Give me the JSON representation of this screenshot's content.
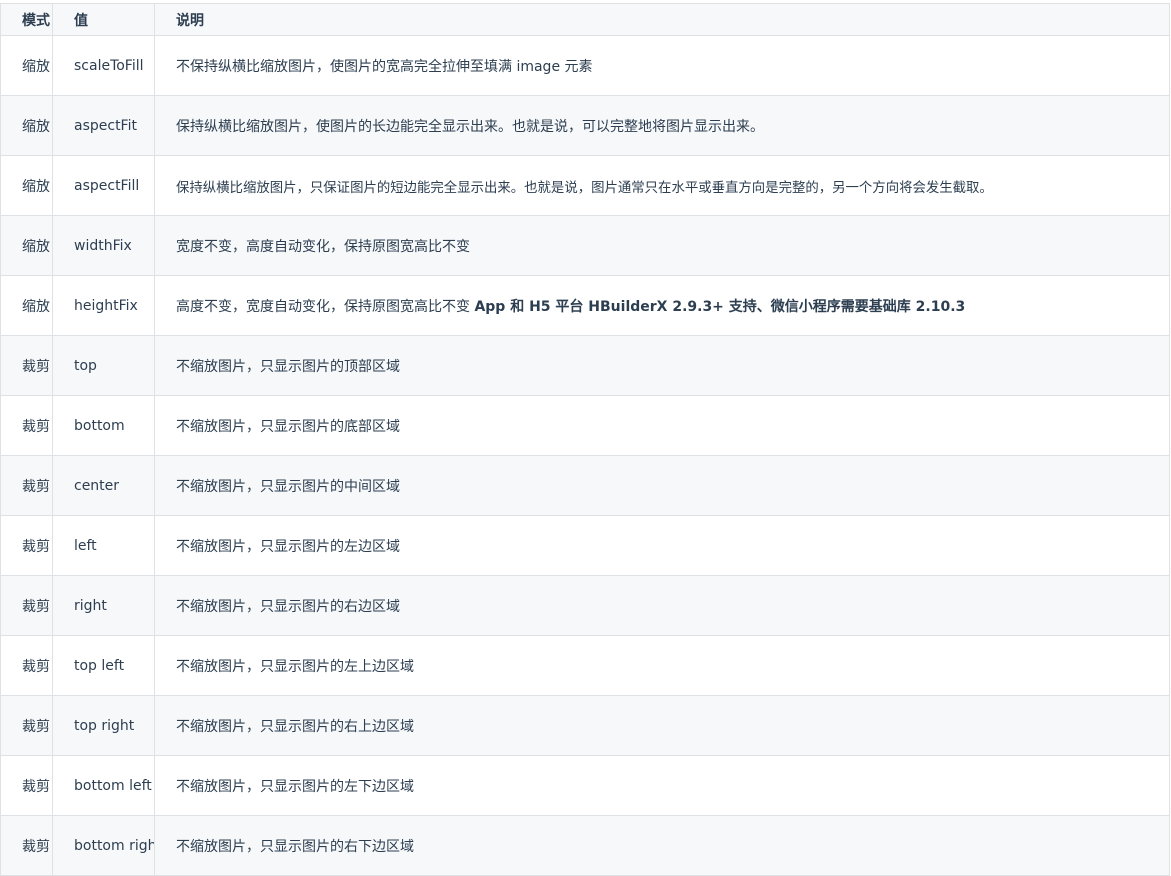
{
  "table": {
    "headers": {
      "mode": "模式",
      "value": "值",
      "desc": "说明"
    },
    "rows": [
      {
        "mode": "缩放",
        "value": "scaleToFill",
        "desc": "不保持纵横比缩放图片，使图片的宽高完全拉伸至填满 image 元素",
        "desc_extra": ""
      },
      {
        "mode": "缩放",
        "value": "aspectFit",
        "desc": "保持纵横比缩放图片，使图片的长边能完全显示出来。也就是说，可以完整地将图片显示出来。",
        "desc_extra": ""
      },
      {
        "mode": "缩放",
        "value": "aspectFill",
        "desc": "保持纵横比缩放图片，只保证图片的短边能完全显示出来。也就是说，图片通常只在水平或垂直方向是完整的，另一个方向将会发生截取。",
        "desc_extra": ""
      },
      {
        "mode": "缩放",
        "value": "widthFix",
        "desc": "宽度不变，高度自动变化，保持原图宽高比不变",
        "desc_extra": ""
      },
      {
        "mode": "缩放",
        "value": "heightFix",
        "desc": "高度不变，宽度自动变化，保持原图宽高比不变",
        "desc_extra": "App 和 H5 平台 HBuilderX 2.9.3+ 支持、微信小程序需要基础库 2.10.3"
      },
      {
        "mode": "裁剪",
        "value": "top",
        "desc": "不缩放图片，只显示图片的顶部区域",
        "desc_extra": ""
      },
      {
        "mode": "裁剪",
        "value": "bottom",
        "desc": "不缩放图片，只显示图片的底部区域",
        "desc_extra": ""
      },
      {
        "mode": "裁剪",
        "value": "center",
        "desc": "不缩放图片，只显示图片的中间区域",
        "desc_extra": ""
      },
      {
        "mode": "裁剪",
        "value": "left",
        "desc": "不缩放图片，只显示图片的左边区域",
        "desc_extra": ""
      },
      {
        "mode": "裁剪",
        "value": "right",
        "desc": "不缩放图片，只显示图片的右边区域",
        "desc_extra": ""
      },
      {
        "mode": "裁剪",
        "value": "top left",
        "desc": "不缩放图片，只显示图片的左上边区域",
        "desc_extra": ""
      },
      {
        "mode": "裁剪",
        "value": "top right",
        "desc": "不缩放图片，只显示图片的右上边区域",
        "desc_extra": ""
      },
      {
        "mode": "裁剪",
        "value": "bottom left",
        "desc": "不缩放图片，只显示图片的左下边区域",
        "desc_extra": ""
      },
      {
        "mode": "裁剪",
        "value": "bottom right",
        "desc": "不缩放图片，只显示图片的右下边区域",
        "desc_extra": ""
      }
    ]
  }
}
